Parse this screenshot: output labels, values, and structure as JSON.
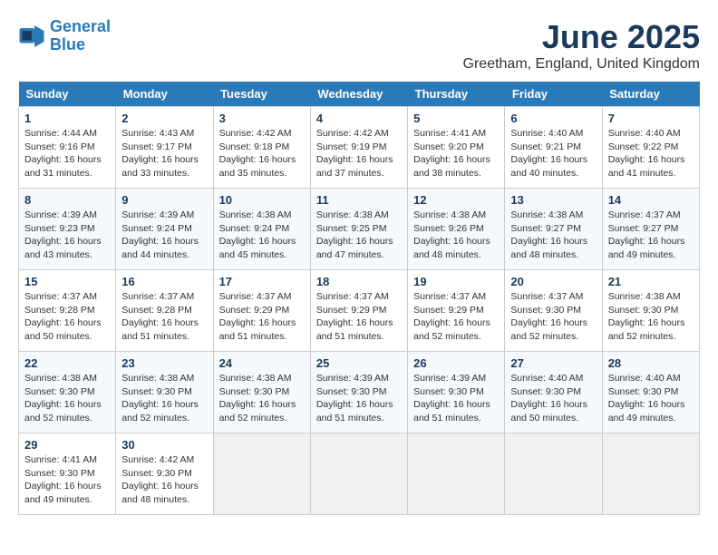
{
  "header": {
    "logo_line1": "General",
    "logo_line2": "Blue",
    "month_title": "June 2025",
    "location": "Greetham, England, United Kingdom"
  },
  "weekdays": [
    "Sunday",
    "Monday",
    "Tuesday",
    "Wednesday",
    "Thursday",
    "Friday",
    "Saturday"
  ],
  "weeks": [
    [
      {
        "day": "1",
        "sunrise": "Sunrise: 4:44 AM",
        "sunset": "Sunset: 9:16 PM",
        "daylight": "Daylight: 16 hours and 31 minutes."
      },
      {
        "day": "2",
        "sunrise": "Sunrise: 4:43 AM",
        "sunset": "Sunset: 9:17 PM",
        "daylight": "Daylight: 16 hours and 33 minutes."
      },
      {
        "day": "3",
        "sunrise": "Sunrise: 4:42 AM",
        "sunset": "Sunset: 9:18 PM",
        "daylight": "Daylight: 16 hours and 35 minutes."
      },
      {
        "day": "4",
        "sunrise": "Sunrise: 4:42 AM",
        "sunset": "Sunset: 9:19 PM",
        "daylight": "Daylight: 16 hours and 37 minutes."
      },
      {
        "day": "5",
        "sunrise": "Sunrise: 4:41 AM",
        "sunset": "Sunset: 9:20 PM",
        "daylight": "Daylight: 16 hours and 38 minutes."
      },
      {
        "day": "6",
        "sunrise": "Sunrise: 4:40 AM",
        "sunset": "Sunset: 9:21 PM",
        "daylight": "Daylight: 16 hours and 40 minutes."
      },
      {
        "day": "7",
        "sunrise": "Sunrise: 4:40 AM",
        "sunset": "Sunset: 9:22 PM",
        "daylight": "Daylight: 16 hours and 41 minutes."
      }
    ],
    [
      {
        "day": "8",
        "sunrise": "Sunrise: 4:39 AM",
        "sunset": "Sunset: 9:23 PM",
        "daylight": "Daylight: 16 hours and 43 minutes."
      },
      {
        "day": "9",
        "sunrise": "Sunrise: 4:39 AM",
        "sunset": "Sunset: 9:24 PM",
        "daylight": "Daylight: 16 hours and 44 minutes."
      },
      {
        "day": "10",
        "sunrise": "Sunrise: 4:38 AM",
        "sunset": "Sunset: 9:24 PM",
        "daylight": "Daylight: 16 hours and 45 minutes."
      },
      {
        "day": "11",
        "sunrise": "Sunrise: 4:38 AM",
        "sunset": "Sunset: 9:25 PM",
        "daylight": "Daylight: 16 hours and 47 minutes."
      },
      {
        "day": "12",
        "sunrise": "Sunrise: 4:38 AM",
        "sunset": "Sunset: 9:26 PM",
        "daylight": "Daylight: 16 hours and 48 minutes."
      },
      {
        "day": "13",
        "sunrise": "Sunrise: 4:38 AM",
        "sunset": "Sunset: 9:27 PM",
        "daylight": "Daylight: 16 hours and 48 minutes."
      },
      {
        "day": "14",
        "sunrise": "Sunrise: 4:37 AM",
        "sunset": "Sunset: 9:27 PM",
        "daylight": "Daylight: 16 hours and 49 minutes."
      }
    ],
    [
      {
        "day": "15",
        "sunrise": "Sunrise: 4:37 AM",
        "sunset": "Sunset: 9:28 PM",
        "daylight": "Daylight: 16 hours and 50 minutes."
      },
      {
        "day": "16",
        "sunrise": "Sunrise: 4:37 AM",
        "sunset": "Sunset: 9:28 PM",
        "daylight": "Daylight: 16 hours and 51 minutes."
      },
      {
        "day": "17",
        "sunrise": "Sunrise: 4:37 AM",
        "sunset": "Sunset: 9:29 PM",
        "daylight": "Daylight: 16 hours and 51 minutes."
      },
      {
        "day": "18",
        "sunrise": "Sunrise: 4:37 AM",
        "sunset": "Sunset: 9:29 PM",
        "daylight": "Daylight: 16 hours and 51 minutes."
      },
      {
        "day": "19",
        "sunrise": "Sunrise: 4:37 AM",
        "sunset": "Sunset: 9:29 PM",
        "daylight": "Daylight: 16 hours and 52 minutes."
      },
      {
        "day": "20",
        "sunrise": "Sunrise: 4:37 AM",
        "sunset": "Sunset: 9:30 PM",
        "daylight": "Daylight: 16 hours and 52 minutes."
      },
      {
        "day": "21",
        "sunrise": "Sunrise: 4:38 AM",
        "sunset": "Sunset: 9:30 PM",
        "daylight": "Daylight: 16 hours and 52 minutes."
      }
    ],
    [
      {
        "day": "22",
        "sunrise": "Sunrise: 4:38 AM",
        "sunset": "Sunset: 9:30 PM",
        "daylight": "Daylight: 16 hours and 52 minutes."
      },
      {
        "day": "23",
        "sunrise": "Sunrise: 4:38 AM",
        "sunset": "Sunset: 9:30 PM",
        "daylight": "Daylight: 16 hours and 52 minutes."
      },
      {
        "day": "24",
        "sunrise": "Sunrise: 4:38 AM",
        "sunset": "Sunset: 9:30 PM",
        "daylight": "Daylight: 16 hours and 52 minutes."
      },
      {
        "day": "25",
        "sunrise": "Sunrise: 4:39 AM",
        "sunset": "Sunset: 9:30 PM",
        "daylight": "Daylight: 16 hours and 51 minutes."
      },
      {
        "day": "26",
        "sunrise": "Sunrise: 4:39 AM",
        "sunset": "Sunset: 9:30 PM",
        "daylight": "Daylight: 16 hours and 51 minutes."
      },
      {
        "day": "27",
        "sunrise": "Sunrise: 4:40 AM",
        "sunset": "Sunset: 9:30 PM",
        "daylight": "Daylight: 16 hours and 50 minutes."
      },
      {
        "day": "28",
        "sunrise": "Sunrise: 4:40 AM",
        "sunset": "Sunset: 9:30 PM",
        "daylight": "Daylight: 16 hours and 49 minutes."
      }
    ],
    [
      {
        "day": "29",
        "sunrise": "Sunrise: 4:41 AM",
        "sunset": "Sunset: 9:30 PM",
        "daylight": "Daylight: 16 hours and 49 minutes."
      },
      {
        "day": "30",
        "sunrise": "Sunrise: 4:42 AM",
        "sunset": "Sunset: 9:30 PM",
        "daylight": "Daylight: 16 hours and 48 minutes."
      },
      null,
      null,
      null,
      null,
      null
    ]
  ]
}
